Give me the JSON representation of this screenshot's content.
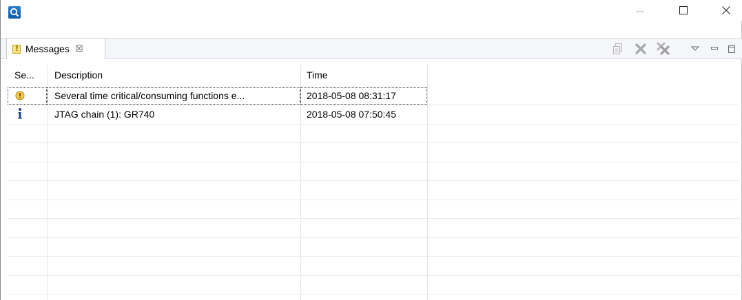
{
  "window": {
    "icon": "search-app-icon",
    "controls": {
      "minimize": "minimize-icon",
      "maximize": "maximize-icon",
      "close": "close-icon"
    }
  },
  "tab": {
    "label": "Messages",
    "icon": "warning-tab-icon",
    "close_glyph": "☒"
  },
  "toolbar": {
    "icons": [
      "copy-icon",
      "remove-icon",
      "remove-all-icon",
      "view-menu-icon",
      "minimize-view-icon",
      "maximize-view-icon"
    ]
  },
  "table": {
    "columns": [
      "Se...",
      "Description",
      "Time"
    ],
    "rows": [
      {
        "severity": "warning",
        "description": "Several time critical/consuming functions e...",
        "time": "2018-05-08 08:31:17"
      },
      {
        "severity": "info",
        "description": "JTAG chain (1): GR740",
        "time": "2018-05-08 07:50:45"
      }
    ]
  },
  "colors": {
    "warning": "#f2c94c",
    "info": "#1d3f8a",
    "accent": "#0f5aa6"
  }
}
